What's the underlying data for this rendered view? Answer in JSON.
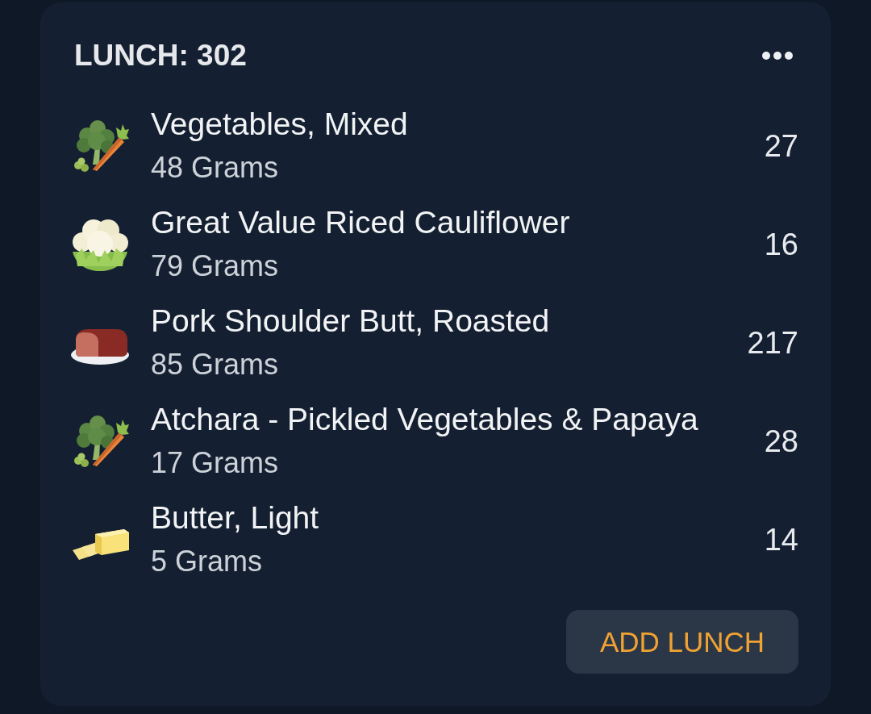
{
  "meal": {
    "title": "LUNCH: 302"
  },
  "items": [
    {
      "kind": "vegetables",
      "name": "Vegetables, Mixed",
      "amount": "48 Grams",
      "calories": "27"
    },
    {
      "kind": "cauliflower",
      "name": "Great Value Riced Cauliflower",
      "amount": "79 Grams",
      "calories": "16"
    },
    {
      "kind": "roast",
      "name": "Pork Shoulder Butt, Roasted",
      "amount": "85 Grams",
      "calories": "217"
    },
    {
      "kind": "vegetables",
      "name": "Atchara - Pickled Vegetables & Papaya",
      "amount": "17 Grams",
      "calories": "28"
    },
    {
      "kind": "butter",
      "name": "Butter, Light",
      "amount": "5 Grams",
      "calories": "14"
    }
  ],
  "add_button": {
    "label": "ADD LUNCH"
  }
}
